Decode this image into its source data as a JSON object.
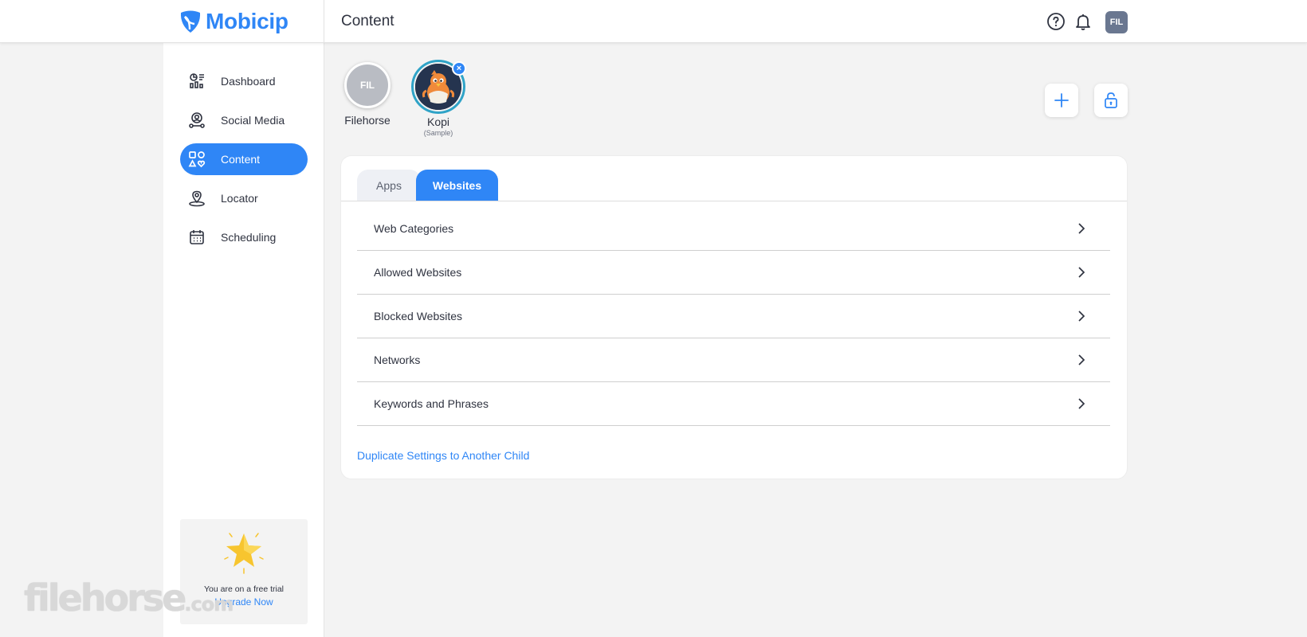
{
  "header": {
    "brand": "Mobicip",
    "page_title": "Content",
    "user_initials": "FIL"
  },
  "sidebar": {
    "items": [
      {
        "label": "Dashboard",
        "icon": "dashboard-icon"
      },
      {
        "label": "Social Media",
        "icon": "social-media-icon"
      },
      {
        "label": "Content",
        "icon": "content-icon",
        "active": true
      },
      {
        "label": "Locator",
        "icon": "location-pin-icon"
      },
      {
        "label": "Scheduling",
        "icon": "calendar-icon"
      }
    ],
    "trial": {
      "text": "You are on a free trial",
      "link": "Upgrade Now"
    },
    "watermark": "filehorse",
    "watermark_suffix": ".com"
  },
  "profiles": [
    {
      "initials": "FIL",
      "name": "Filehorse"
    },
    {
      "name": "Kopi",
      "subtitle": "(Sample)",
      "selected": true
    }
  ],
  "tabs": [
    {
      "label": "Apps"
    },
    {
      "label": "Websites",
      "active": true
    }
  ],
  "rows": [
    {
      "label": "Web Categories"
    },
    {
      "label": "Allowed Websites"
    },
    {
      "label": "Blocked Websites"
    },
    {
      "label": "Networks"
    },
    {
      "label": "Keywords and Phrases"
    }
  ],
  "duplicate_link": "Duplicate Settings to Another Child",
  "colors": {
    "accent": "#2f86f6",
    "background": "#f3f3f3",
    "avatar_bg": "#6a7790"
  }
}
